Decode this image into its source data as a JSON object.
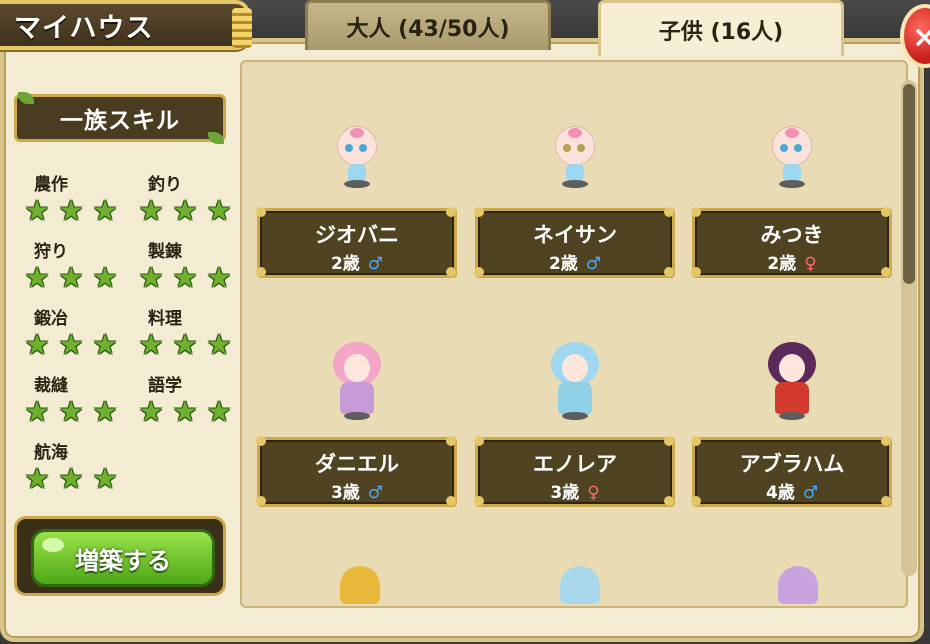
{
  "header": {
    "title": "マイハウス",
    "tabs": [
      {
        "label": "大人 (43/50人)",
        "active": false
      },
      {
        "label": "子供 (16人)",
        "active": true
      }
    ]
  },
  "sidebar": {
    "skills_title": "一族スキル",
    "skills": [
      {
        "name": "農作",
        "stars": 3
      },
      {
        "name": "釣り",
        "stars": 3
      },
      {
        "name": "狩り",
        "stars": 3
      },
      {
        "name": "製錬",
        "stars": 3
      },
      {
        "name": "鍛冶",
        "stars": 3
      },
      {
        "name": "料理",
        "stars": 3
      },
      {
        "name": "裁縫",
        "stars": 3
      },
      {
        "name": "語学",
        "stars": 3
      },
      {
        "name": "航海",
        "stars": 3
      }
    ],
    "build_button": "増築する"
  },
  "children": [
    {
      "name": "ジオバニ",
      "age": "2歳",
      "gender": "♂"
    },
    {
      "name": "ネイサン",
      "age": "2歳",
      "gender": "♂"
    },
    {
      "name": "みつき",
      "age": "2歳",
      "gender": "♀"
    },
    {
      "name": "ダニエル",
      "age": "3歳",
      "gender": "♂"
    },
    {
      "name": "エノレア",
      "age": "3歳",
      "gender": "♀"
    },
    {
      "name": "アブラハム",
      "age": "4歳",
      "gender": "♂"
    }
  ],
  "icons": {
    "star": "★",
    "close": "×",
    "male": "♂",
    "female": "♀"
  },
  "colors": {
    "male": "#4aa8ff",
    "female": "#ff6b6b",
    "star": "#6fb12f",
    "button_green": "#4ea818",
    "close_red": "#c9201a"
  }
}
